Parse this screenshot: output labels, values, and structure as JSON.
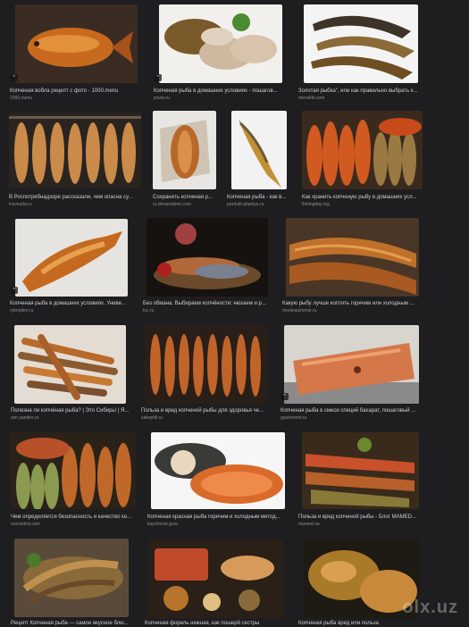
{
  "results": [
    {
      "caption": "Копченая вобла рецепт с фото - 1000.menu",
      "source": "1000.menu"
    },
    {
      "caption": "Копченая рыба в домашних условиях - пошагов...",
      "source": "povar.ru"
    },
    {
      "caption": "Золотая рыбка\", или как правильно выбрать к...",
      "source": "menslife.com"
    },
    {
      "caption": "В Роспотребнадзоре рассказали, чем опасна су...",
      "source": "tvzvezda.ru"
    },
    {
      "caption": "Сохранить копченая р...",
      "source": "ru.dreamstime.com"
    },
    {
      "caption": "Копченая рыба - как в...",
      "source": "produkt-pitaniya.ru"
    },
    {
      "caption": "Как хранить копченую рыбу в домашних усл...",
      "source": "fishingday.org"
    },
    {
      "caption": "Копченая рыба в домашних условиях. Униве...",
      "source": "rybnyden.ru"
    },
    {
      "caption": "Без обмана. Выбираем копчёности: нюхаем и р...",
      "source": "tvc.ru"
    },
    {
      "caption": "Какую рыбу лучше коптить горячим или холодным ...",
      "source": "moekopchenie.ru"
    },
    {
      "caption": "Полезна ли копчёная рыба? | Это Сибирь! | Я...",
      "source": "zen.yandex.ru"
    },
    {
      "caption": "Польза и вред копченой рыбы для здоровья че...",
      "source": "zakoptili.ru"
    },
    {
      "caption": "Копченая рыба в смеси специй бахарат, пошаговый ...",
      "source": "gastronom.ru"
    },
    {
      "caption": "Чем определяется безопасность и качество ко...",
      "source": "roscontrol.com"
    },
    {
      "caption": "Копченая красная рыба горячим и холодным метод...",
      "source": "kopchenie.guru"
    },
    {
      "caption": "Польза и вред копченой рыбы - Блог MAMED...",
      "source": "mamed.ua"
    },
    {
      "caption": "Рецепт Копченая рыба — самое вкусное блю...",
      "source": ""
    },
    {
      "caption": "Копченая форель нежная, как пошерй сестры",
      "source": ""
    },
    {
      "caption": "Копченая рыба вред или польза",
      "source": ""
    }
  ],
  "quote_glyph": "”",
  "watermark": "olx.uz"
}
